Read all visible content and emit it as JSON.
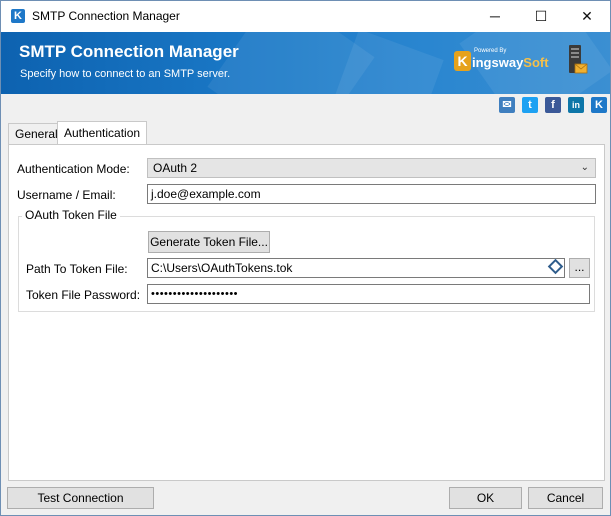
{
  "window": {
    "title": "SMTP Connection Manager",
    "app_icon": "K",
    "controls": {
      "minimize": "─",
      "maximize": "☐",
      "close": "✕"
    }
  },
  "banner": {
    "title": "SMTP Connection Manager",
    "subtitle": "Specify how to connect to an SMTP server.",
    "logo": {
      "powered": "Powered By",
      "brand_main": "ingsway",
      "brand_accent": "Soft",
      "mark": "K"
    },
    "colors": {
      "start": "#0d62b0",
      "end": "#3b8fd2"
    }
  },
  "social": [
    {
      "name": "email-icon",
      "glyph": "✉"
    },
    {
      "name": "twitter-icon",
      "glyph": "t"
    },
    {
      "name": "facebook-icon",
      "glyph": "f"
    },
    {
      "name": "linkedin-icon",
      "glyph": "in"
    },
    {
      "name": "kingswaysoft-icon",
      "glyph": "K"
    }
  ],
  "tabs": [
    {
      "label": "General",
      "active": false
    },
    {
      "label": "Authentication",
      "active": true
    }
  ],
  "form": {
    "auth_mode_label": "Authentication Mode:",
    "auth_mode_value": "OAuth 2",
    "username_label": "Username / Email:",
    "username_value": "j.doe@example.com",
    "group_title": "OAuth Token File",
    "generate_button": "Generate Token File...",
    "path_label": "Path To Token File:",
    "path_value": "C:\\Users\\OAuthTokens.tok",
    "browse_button": "...",
    "password_label": "Token File Password:",
    "password_value": "••••••••••••••••••••"
  },
  "footer": {
    "test_button": "Test Connection",
    "ok_button": "OK",
    "cancel_button": "Cancel"
  }
}
